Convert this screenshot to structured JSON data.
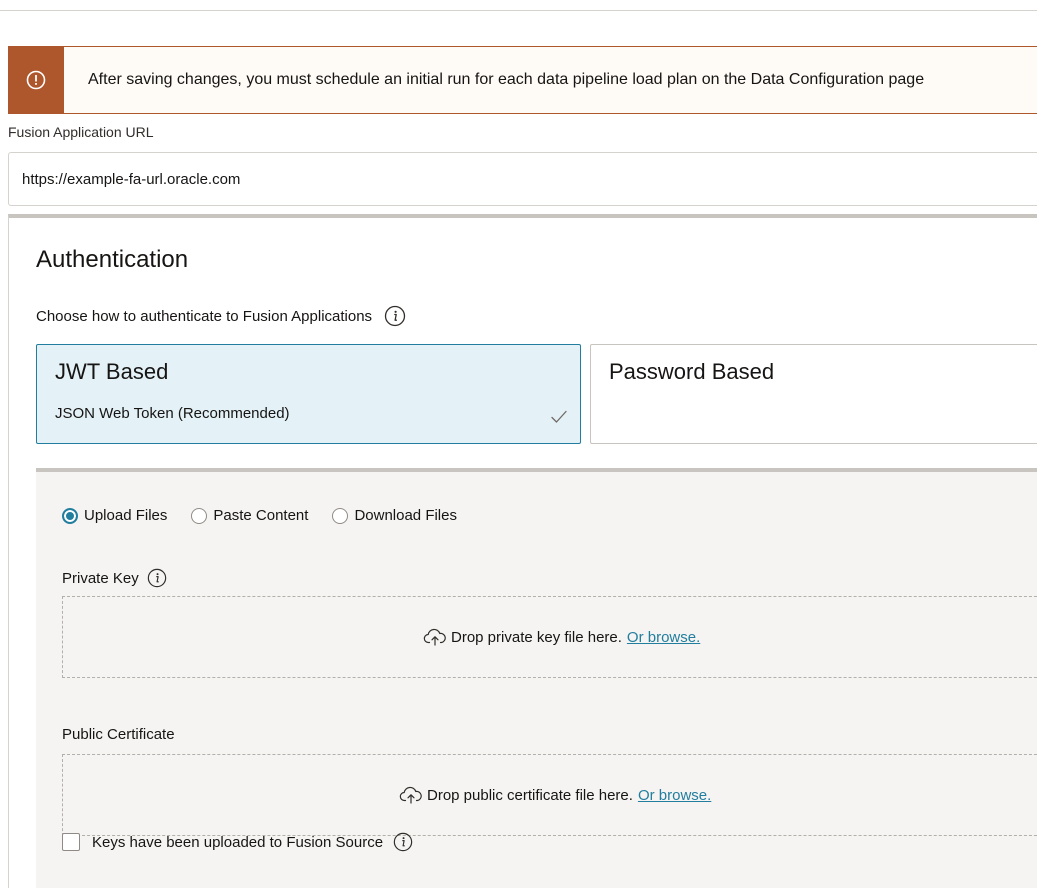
{
  "banner": {
    "message": "After saving changes, you must schedule an initial run for each data pipeline load plan on the Data Configuration page",
    "icon": "warning-exclamation-icon",
    "color": "#ae562c"
  },
  "fusion_url": {
    "label": "Fusion Application URL",
    "value": "https://example-fa-url.oracle.com"
  },
  "authentication": {
    "title": "Authentication",
    "subtitle": "Choose how to authenticate to Fusion Applications",
    "options": [
      {
        "title": "JWT Based",
        "description": "JSON Web Token (Recommended)",
        "selected": true
      },
      {
        "title": "Password Based",
        "description": "",
        "selected": false
      }
    ]
  },
  "key_source": {
    "options": [
      {
        "label": "Upload Files",
        "selected": true
      },
      {
        "label": "Paste Content",
        "selected": false
      },
      {
        "label": "Download Files",
        "selected": false
      }
    ]
  },
  "private_key": {
    "label": "Private Key",
    "drop_text": "Drop private key file here.",
    "browse_link": "Or browse."
  },
  "public_certificate": {
    "label": "Public Certificate",
    "drop_text": "Drop public certificate file here.",
    "browse_link": "Or browse."
  },
  "keys_uploaded": {
    "label": "Keys have been uploaded to Fusion Source",
    "checked": false
  },
  "colors": {
    "accent": "#227e9e",
    "warning": "#ae562c",
    "selected_card_bg": "#e4f1f7"
  }
}
